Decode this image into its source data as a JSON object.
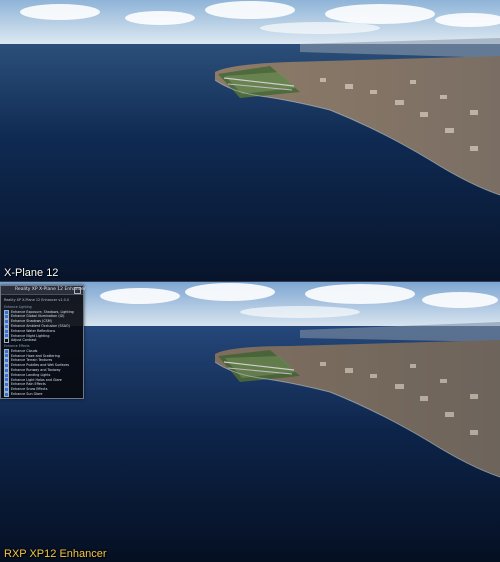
{
  "panels": [
    {
      "caption": "X-Plane 12"
    },
    {
      "caption": "RXP XP12 Enhancer"
    }
  ],
  "plugin_window": {
    "title": "Reality XP X-Plane 12 Enhancer",
    "version": "Reality XP X-Plane 12 Enhancer v1.0.0",
    "section_label": "Enhance Lighting",
    "options": [
      {
        "label": "Enhance Exposure, Shadows, Lighting",
        "checked": true
      },
      {
        "label": "Enhance Global Illumination (GI)",
        "checked": true
      },
      {
        "label": "Enhance Shadows (CSM)",
        "checked": true
      },
      {
        "label": "Enhance Ambient Occlusion (SSAO)",
        "checked": true
      },
      {
        "label": "Enhance Water Reflections",
        "checked": true
      },
      {
        "label": "Enhance Night Lighting",
        "checked": true
      },
      {
        "label": "Adjust Contrast",
        "checked": false
      }
    ],
    "sub_label": "Enhance Effects",
    "options2": [
      {
        "label": "Enhance Clouds",
        "checked": true
      },
      {
        "label": "Enhance Haze and Scattering",
        "checked": true
      },
      {
        "label": "Enhance Terrain Textures",
        "checked": true
      },
      {
        "label": "Enhance Puddles and Wet Surfaces",
        "checked": true
      },
      {
        "label": "Enhance Runway and Taxiway",
        "checked": true
      },
      {
        "label": "Enhance Landing Lights",
        "checked": true
      },
      {
        "label": "Enhance Light Halos and Glare",
        "checked": true
      },
      {
        "label": "Enhance Rain Effects",
        "checked": true
      },
      {
        "label": "Enhance Snow Effects",
        "checked": true
      },
      {
        "label": "Enhance Sun Glare",
        "checked": true
      }
    ]
  }
}
